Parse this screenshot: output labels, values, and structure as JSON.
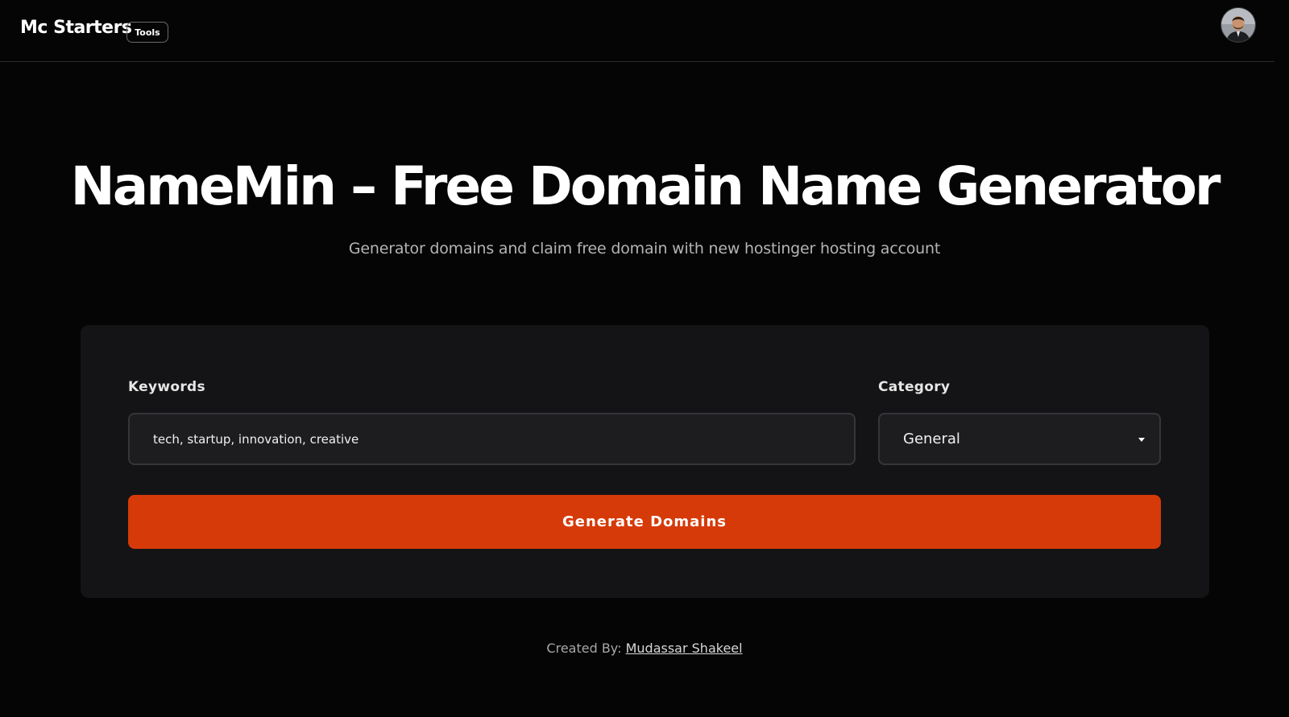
{
  "header": {
    "logo_text": "Mc Starters",
    "badge_text": "Tools",
    "avatar_icon": "user-avatar-icon"
  },
  "hero": {
    "title": "NameMin – Free Domain Name Generator",
    "subtitle": "Generator domains and claim free domain with new hostinger hosting account"
  },
  "form": {
    "keywords_label": "Keywords",
    "keywords_value": "tech, startup, innovation, creative",
    "category_label": "Category",
    "category_value": "General",
    "generate_label": "Generate Domains"
  },
  "footer": {
    "created_by_label": "Created By:",
    "author_name": "Mudassar Shakeel"
  },
  "colors": {
    "background": "#050505",
    "card": "#141416",
    "accent": "#d63a08"
  }
}
